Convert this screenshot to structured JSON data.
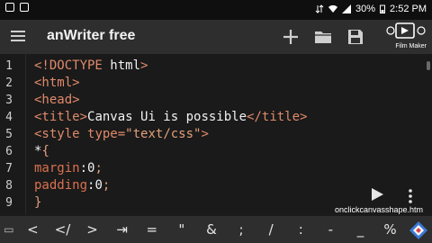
{
  "status_bar": {
    "battery": "30%",
    "time": "2:52 PM"
  },
  "app": {
    "title": "anWriter free",
    "watermark": "Film Maker"
  },
  "editor": {
    "lines": [
      {
        "num": "1",
        "parts": [
          {
            "t": "<!DOCTYPE ",
            "c": "tag"
          },
          {
            "t": "html",
            "c": "plain"
          },
          {
            "t": ">",
            "c": "tag"
          }
        ]
      },
      {
        "num": "2",
        "parts": [
          {
            "t": "<html>",
            "c": "tag"
          }
        ]
      },
      {
        "num": "3",
        "parts": [
          {
            "t": "<head>",
            "c": "tag"
          }
        ]
      },
      {
        "num": "4",
        "parts": [
          {
            "t": "<title>",
            "c": "tag"
          },
          {
            "t": "Canvas Ui is possible",
            "c": "plain"
          },
          {
            "t": "</title>",
            "c": "tag"
          }
        ]
      },
      {
        "num": "5",
        "parts": [
          {
            "t": "<style ",
            "c": "tag"
          },
          {
            "t": "type=",
            "c": "attr"
          },
          {
            "t": "\"text/css\"",
            "c": "str"
          },
          {
            "t": ">",
            "c": "tag"
          }
        ]
      },
      {
        "num": "6",
        "parts": [
          {
            "t": "*",
            "c": "plain"
          },
          {
            "t": "{",
            "c": "brace"
          }
        ]
      },
      {
        "num": "7",
        "parts": [
          {
            "t": "margin",
            "c": "prop"
          },
          {
            "t": ":",
            "c": "plain"
          },
          {
            "t": "0",
            "c": "num"
          },
          {
            "t": ";",
            "c": "brace"
          }
        ]
      },
      {
        "num": "8",
        "parts": [
          {
            "t": "padding",
            "c": "prop"
          },
          {
            "t": ":",
            "c": "plain"
          },
          {
            "t": "0",
            "c": "num"
          },
          {
            "t": ";",
            "c": "brace"
          }
        ]
      },
      {
        "num": "9",
        "parts": [
          {
            "t": "}",
            "c": "brace"
          }
        ]
      }
    ],
    "overlay_text": "onclickcanvasshape.htm"
  },
  "symbol_keys": [
    "<",
    "</",
    ">",
    "⇥",
    "=",
    "\"",
    "&",
    ";",
    "/",
    ":",
    "-",
    "_",
    "%"
  ],
  "colors": {
    "background": "#1b1b1b",
    "appbar": "#2e2e2e",
    "tag": "#e08a6a",
    "property": "#d9714e",
    "text": "#f2f2f2"
  },
  "icons": [
    "menu-icon",
    "add-icon",
    "folder-icon",
    "save-icon",
    "run-icon",
    "more-icon"
  ]
}
